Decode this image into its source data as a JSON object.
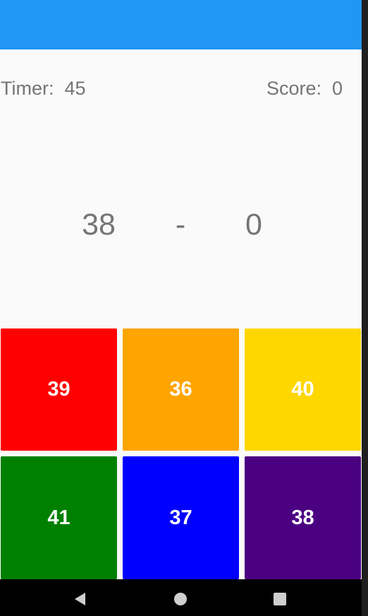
{
  "app_bar": {
    "color": "#2196f3"
  },
  "status": {
    "timer_text": "Timer:  45",
    "score_text": "Score:  0"
  },
  "equation": {
    "operand_a": "38",
    "operator": "-",
    "operand_b": "0"
  },
  "answers": [
    {
      "label": "39",
      "color": "#ff0000"
    },
    {
      "label": "36",
      "color": "#ffa500"
    },
    {
      "label": "40",
      "color": "#ffd700"
    },
    {
      "label": "41",
      "color": "#008000"
    },
    {
      "label": "37",
      "color": "#0000ff"
    },
    {
      "label": "38",
      "color": "#4b0082"
    }
  ],
  "nav": {
    "back_icon": "back-triangle-icon",
    "home_icon": "home-circle-icon",
    "recent_icon": "recent-square-icon"
  }
}
